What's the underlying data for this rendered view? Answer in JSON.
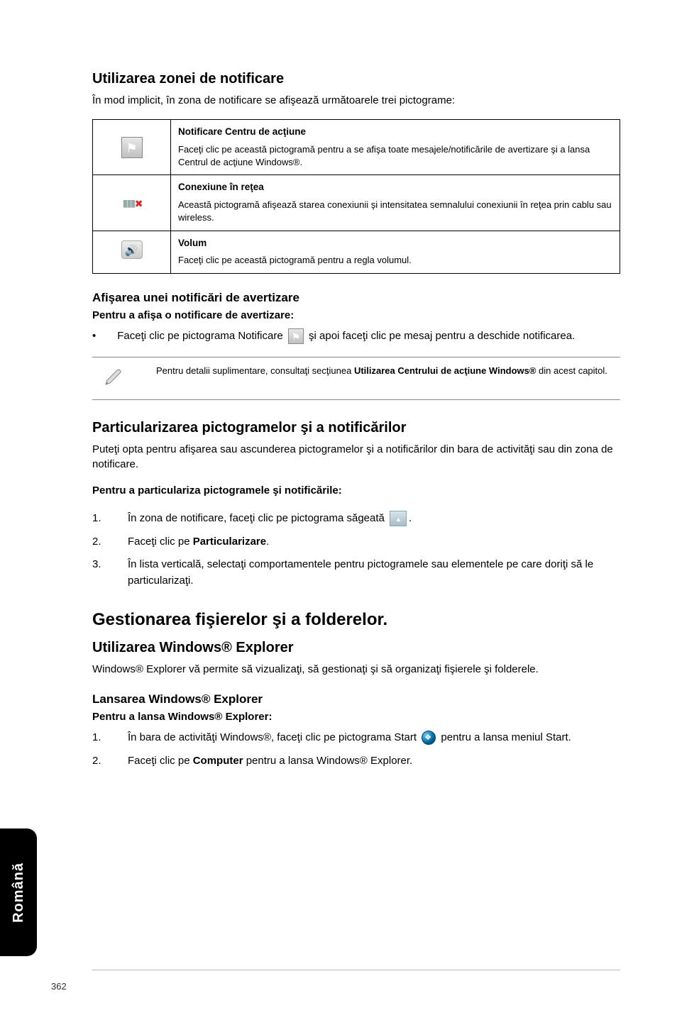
{
  "section1": {
    "title": "Utilizarea zonei de notificare",
    "intro": "În mod implicit, în zona de notificare se afişează următoarele trei pictograme:",
    "table": [
      {
        "title": "Notificare Centru de acţiune",
        "desc": "Faceţi clic pe această pictogramă pentru a se afişa toate mesajele/notificările de avertizare şi a lansa Centrul de acţiune Windows®."
      },
      {
        "title": "Conexiune în reţea",
        "desc": "Această pictogramă afişează starea conexiunii şi intensitatea semnalului conexiunii în reţea prin cablu sau wireless."
      },
      {
        "title": "Volum",
        "desc": "Faceţi clic pe această pictogramă pentru a regla volumul."
      }
    ],
    "sub1_title": "Afişarea unei notificări de avertizare",
    "sub1_lead": "Pentru a afişa o notificare de avertizare:",
    "sub1_bullet_pre": "Faceţi clic pe pictograma Notificare ",
    "sub1_bullet_post": " şi apoi faceţi clic pe mesaj pentru a deschide notificarea.",
    "note_pre": "Pentru detalii suplimentare, consultaţi secţiunea ",
    "note_bold": "Utilizarea Centrului de acţiune Windows®",
    "note_post": " din acest capitol."
  },
  "section2": {
    "title": "Particularizarea pictogramelor şi a notificărilor",
    "intro": "Puteţi opta pentru afişarea sau ascunderea pictogramelor şi a notificărilor din bara de activităţi sau din zona de notificare.",
    "lead": "Pentru a particulariza pictogramele şi notificările:",
    "steps": [
      {
        "pre": "În zona de notificare, faceţi clic pe pictograma săgeată ",
        "post": "."
      },
      {
        "pre": "Faceţi clic pe ",
        "bold": "Particularizare",
        "post": "."
      },
      {
        "pre": "În lista verticală, selectaţi comportamentele pentru pictogramele sau elementele pe care doriţi să le particularizaţi."
      }
    ]
  },
  "section3": {
    "title": "Gestionarea fişierelor şi a folderelor.",
    "sub_title": "Utilizarea Windows® Explorer",
    "intro": "Windows® Explorer vă permite să vizualizaţi, să gestionaţi şi să organizaţi fişierele şi folderele.",
    "sub2_title": "Lansarea Windows® Explorer",
    "lead": "Pentru a lansa Windows® Explorer:",
    "steps": [
      {
        "pre": "În bara de activităţi Windows®, faceţi clic pe pictograma Start ",
        "post": " pentru a lansa meniul Start."
      },
      {
        "pre": "Faceţi clic pe ",
        "bold": "Computer",
        "post": " pentru a lansa Windows® Explorer."
      }
    ]
  },
  "side_label": "Română",
  "page_number": "362",
  "step_numbers": [
    "1.",
    "2.",
    "3."
  ],
  "bullet_char": "•"
}
